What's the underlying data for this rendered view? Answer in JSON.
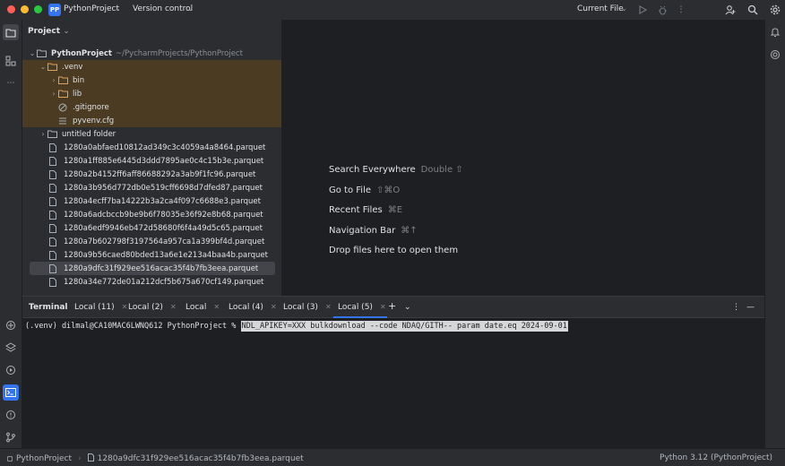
{
  "titlebar": {
    "project_badge": "PP",
    "project_name": "PythonProject",
    "vcs_label": "Version control",
    "run_config": "Current File",
    "colors": {
      "close": "#ff5f57",
      "minimize": "#febc2e",
      "zoom": "#28c840",
      "accent": "#3574f0"
    }
  },
  "project_pane": {
    "header": "Project",
    "root": {
      "name": "PythonProject",
      "path": "~/PycharmProjects/PythonProject"
    },
    "venv": {
      "name": ".venv",
      "children": [
        "bin",
        "lib",
        ".gitignore",
        "pyvenv.cfg"
      ]
    },
    "untitled": "untitled folder",
    "files": [
      "1280a0abfaed10812ad349c3c4059a4a8464.parquet",
      "1280a1ff885e6445d3ddd7895ae0c4c15b3e.parquet",
      "1280a2b4152ff6aff86688292a3ab9f1fc96.parquet",
      "1280a3b956d772db0e519cff6698d7dfed87.parquet",
      "1280a4ecff7ba14222b3a2ca4f097c6688e3.parquet",
      "1280a6adcbccb9be9b6f78035e36f92e8b68.parquet",
      "1280a6edf9946eb472d58680f6f4a49d5c65.parquet",
      "1280a7b602798f3197564a957ca1a399bf4d.parquet",
      "1280a9b56caed80bded13a6e1e213a4baa4b.parquet",
      "1280a9dfc31f929ee516acac35f4b7fb3eea.parquet",
      "1280a34e772de01a212dcf5b675a670cf149.parquet"
    ]
  },
  "editor_hints": [
    {
      "label": "Search Everywhere",
      "shortcut": "Double ⇧"
    },
    {
      "label": "Go to File",
      "shortcut": "⇧⌘O"
    },
    {
      "label": "Recent Files",
      "shortcut": "⌘E"
    },
    {
      "label": "Navigation Bar",
      "shortcut": "⌘↑"
    },
    {
      "label": "Drop files here to open them",
      "shortcut": ""
    }
  ],
  "terminal": {
    "title": "Terminal",
    "tabs": [
      "Local (11)",
      "Local (2)",
      "Local",
      "Local (4)",
      "Local (3)",
      "Local (5)"
    ],
    "active_tab": "Local (5)",
    "prompt": "(.venv) dilmal@CA10MAC6LWNQ612 PythonProject %",
    "command": "NDL_APIKEY=XXX bulkdownload --code NDAQ/GITH-- param date.eq 2024-09-01"
  },
  "statusbar": {
    "breadcrumb_project": "PythonProject",
    "breadcrumb_file": "1280a9dfc31f929ee516acac35f4b7fb3eea.parquet",
    "interpreter": "Python 3.12 (PythonProject)"
  }
}
